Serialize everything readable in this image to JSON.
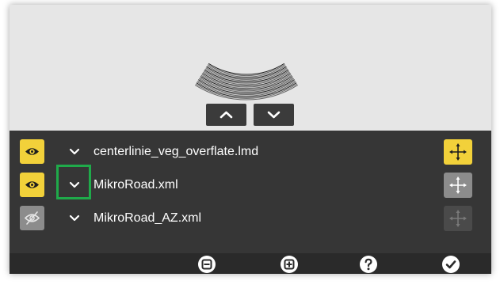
{
  "colors": {
    "preview_bg": "#e6e6e6",
    "panel_bg": "#363636",
    "footer_bg": "#2a2a2a",
    "accent_yellow": "#f2d13a",
    "inactive_gray": "#8c8c8c",
    "highlight_green": "#1faa4a",
    "text": "#ffffff"
  },
  "preview": {
    "nav_buttons": [
      {
        "icon": "chevron-up-icon"
      },
      {
        "icon": "chevron-down-icon"
      }
    ]
  },
  "layers": [
    {
      "file": "centerlinie_veg_overflate.lmd",
      "visible": true,
      "move_state": "active",
      "eye_icon": "eye-icon"
    },
    {
      "file": "MikroRoad.xml",
      "visible": true,
      "move_state": "normal",
      "eye_icon": "eye-icon"
    },
    {
      "file": "MikroRoad_AZ.xml",
      "visible": false,
      "move_state": "disabled",
      "eye_icon": "eye-off-icon"
    }
  ],
  "footer": {
    "buttons": [
      {
        "icon": "minus-circle-icon"
      },
      {
        "icon": "plus-circle-icon"
      },
      {
        "icon": "help-icon"
      },
      {
        "icon": "check-icon"
      }
    ]
  }
}
